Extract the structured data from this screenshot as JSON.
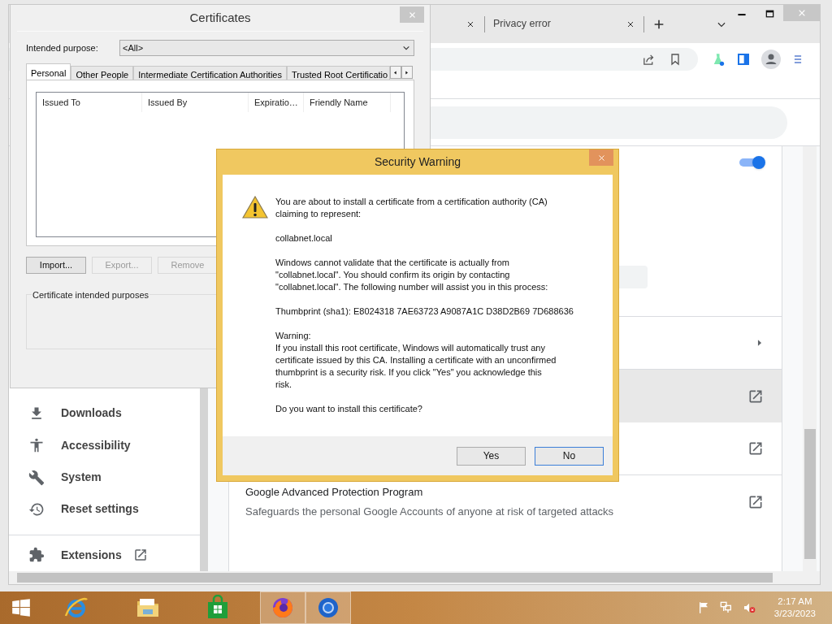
{
  "browser": {
    "tabs": [
      {
        "label": "Privacy error"
      }
    ],
    "toggle": {
      "on": true
    },
    "sidebar": {
      "items": [
        {
          "label": "Downloads",
          "external": false
        },
        {
          "label": "Accessibility",
          "external": false
        },
        {
          "label": "System",
          "external": false
        },
        {
          "label": "Reset settings",
          "external": false
        },
        {
          "label": "Extensions",
          "external": true
        }
      ]
    },
    "rows": [
      {
        "kind": "arrow",
        "hovered": false
      },
      {
        "kind": "external",
        "hovered": true
      },
      {
        "kind": "external",
        "hovered": false
      },
      {
        "kind": "external",
        "hovered": false,
        "title": "Google Advanced Protection Program",
        "description": "Safeguards the personal Google Accounts of anyone at risk of targeted attacks"
      }
    ]
  },
  "certificates": {
    "title": "Certificates",
    "purpose_label": "Intended purpose:",
    "purpose_value": "<All>",
    "tabs": [
      {
        "label": "Personal",
        "selected": true
      },
      {
        "label": "Other People",
        "selected": false
      },
      {
        "label": "Intermediate Certification Authorities",
        "selected": false
      },
      {
        "label": "Trusted Root Certificatio",
        "selected": false
      }
    ],
    "columns": [
      "Issued To",
      "Issued By",
      "Expiratio…",
      "Friendly Name"
    ],
    "buttons": [
      {
        "label": "Import...",
        "disabled": false
      },
      {
        "label": "Export...",
        "disabled": true
      },
      {
        "label": "Remove",
        "disabled": true
      }
    ],
    "purposes_label": "Certificate intended purposes"
  },
  "security_warning": {
    "title": "Security Warning",
    "intro": [
      "You are about to install a certificate from a certification authority (CA)",
      "claiming to represent:"
    ],
    "subject": "collabnet.local",
    "validate": [
      "Windows cannot validate that the certificate is actually from",
      "\"collabnet.local\". You should confirm its origin by contacting",
      "\"collabnet.local\". The following number will assist you in this process:"
    ],
    "thumbprint": "Thumbprint (sha1): E8024318 7AE63723 A9087A1C D38D2B69 7D688636",
    "warning_label": "Warning:",
    "warning": [
      "If you install this root certificate, Windows will automatically trust any",
      "certificate issued by this CA. Installing a certificate with an unconfirmed",
      "thumbprint is a security risk. If you click \"Yes\" you acknowledge this",
      "risk."
    ],
    "question": "Do you want to install this certificate?",
    "buttons": [
      {
        "label": "Yes",
        "default": false
      },
      {
        "label": "No",
        "default": true
      }
    ]
  },
  "taskbar": {
    "apps": [
      {
        "active": false
      },
      {
        "active": false
      },
      {
        "active": false
      },
      {
        "active": true
      },
      {
        "active": true
      }
    ],
    "clock": {
      "time": "2:17 AM",
      "date": "3/23/2023"
    }
  }
}
